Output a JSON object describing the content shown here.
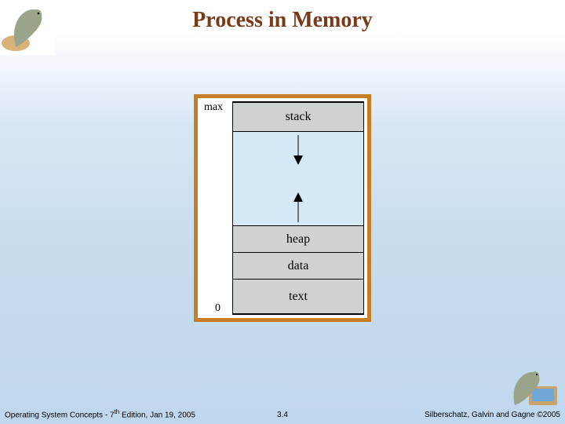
{
  "title": "Process in Memory",
  "diagram": {
    "label_top": "max",
    "label_bottom": "0",
    "segments": {
      "stack": "stack",
      "heap": "heap",
      "data": "data",
      "text": "text"
    }
  },
  "footer": {
    "left_prefix": "Operating System Concepts - 7",
    "left_sup": "th",
    "left_suffix": " Edition, Jan 19, 2005",
    "center": "3.4",
    "right": "Silberschatz, Galvin and Gagne ©2005"
  },
  "logo_alt": "dinosaur-mascot"
}
